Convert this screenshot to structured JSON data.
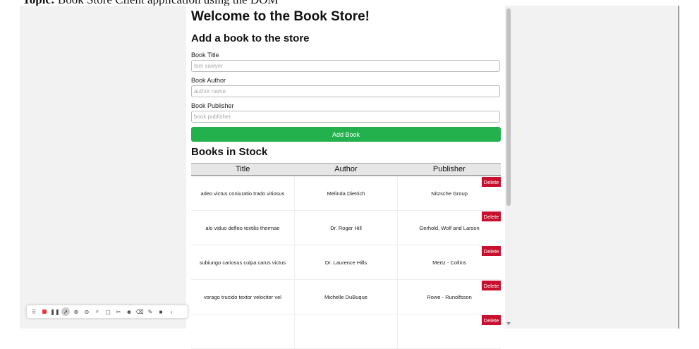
{
  "document": {
    "topic_label": "Topic:",
    "topic_text": "Book Store Client application using the DOM"
  },
  "app": {
    "title": "Welcome to the Book Store!",
    "add_section_title": "Add a book to the store",
    "form": {
      "title_label": "Book Title",
      "title_placeholder": "tom sawyer",
      "author_label": "Book Author",
      "author_placeholder": "author name",
      "publisher_label": "Book Publisher",
      "publisher_placeholder": "book publisher",
      "submit_label": "Add Book"
    },
    "stock_title": "Books in Stock",
    "table": {
      "headers": [
        "Title",
        "Author",
        "Publisher"
      ],
      "delete_label": "Delete",
      "rows": [
        {
          "title": "adeo victus coniuratio trado vitiosus",
          "author": "Melinda Dietrich",
          "publisher": "Nitzsche Group"
        },
        {
          "title": "alo viduo defleo textilis thermae",
          "author": "Dr. Roger Hill",
          "publisher": "Gerhold, Wolf and Larson"
        },
        {
          "title": "subiungo cariosus culpa carus victus",
          "author": "Dr. Laurence Hills",
          "publisher": "Mertz - Collins"
        },
        {
          "title": "vorago trucido textor velociter vel",
          "author": "Michelle DuBuque",
          "publisher": "Rowe - Runolfsson"
        },
        {
          "title": "",
          "author": "",
          "publisher": ""
        }
      ]
    }
  },
  "colors": {
    "add_button": "#22b14c",
    "delete_button": "#c8102e",
    "table_header_bg": "#e6e6e6"
  },
  "toolbar_icons": [
    "drag-handle-icon",
    "record-icon",
    "pause-icon",
    "pointer-icon",
    "zoom-in-icon",
    "zoom-out-icon",
    "search-icon",
    "crop-icon",
    "scissors-icon",
    "emoji-icon",
    "eraser-icon",
    "pen-icon",
    "camera-icon",
    "collapse-icon"
  ]
}
